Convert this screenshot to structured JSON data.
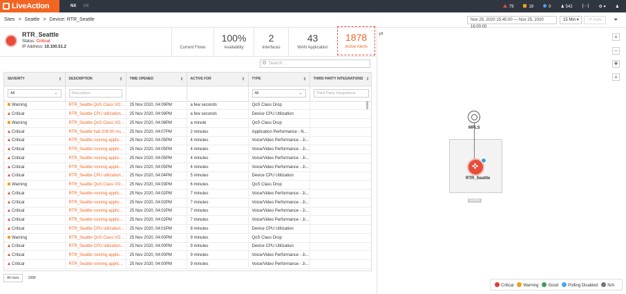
{
  "app": {
    "logo_text": "LiveAction",
    "tabs": [
      "NX",
      "UX"
    ]
  },
  "topbar": {
    "critical_count": "79",
    "warning_count": "19",
    "other_count": "0",
    "users_count": "542",
    "menu_label": "{···}"
  },
  "breadcrumb": [
    "Sites",
    ">",
    "Seattle",
    ">",
    "Device: RTR_Seattle"
  ],
  "timebar": {
    "range": "Nov 25, 2020 15:45:00 — Nov 25, 2020 16:00:00",
    "interval": "15 Min",
    "auto_label": "Auto"
  },
  "device": {
    "name": "RTR_Seattle",
    "status_label": "Status:",
    "status_value": "Critical",
    "ip_label": "IP Address:",
    "ip_value": "10.100.51.2"
  },
  "kpis": [
    {
      "value": "",
      "label": "Current Flows"
    },
    {
      "value": "100%",
      "label": "Availability"
    },
    {
      "value": "2",
      "label": "Interfaces"
    },
    {
      "value": "43",
      "label": "WAN Application"
    },
    {
      "value": "1878",
      "label": "Active Alerts"
    }
  ],
  "search": {
    "placeholder": "Search..."
  },
  "table": {
    "columns": [
      "SEVERITY",
      "DESCRIPTION",
      "TIME OPENED",
      "ACTIVE FOR",
      "TYPE",
      "THIRD PARTY INTEGRATIONS"
    ],
    "filters": {
      "severity": "All",
      "description": "Description",
      "type": "All",
      "integrations": "Third Party Integrations"
    },
    "rows": [
      {
        "sev": "Warning",
        "desc": "RTR_Seattle QoS Class VOIC...",
        "time": "25 Nov 2020, 04:09PM",
        "active": "a few seconds",
        "type": "QoS Class Drop"
      },
      {
        "sev": "Critical",
        "desc": "RTR_Seattle CPU utilization is...",
        "time": "25 Nov 2020, 04:09PM",
        "active": "a few seconds",
        "type": "Device CPU Utilization"
      },
      {
        "sev": "Warning",
        "desc": "RTR_Seattle QoS Class VOIC...",
        "time": "25 Nov 2020, 04:08PM",
        "active": "a minute",
        "type": "QoS Class Drop"
      },
      {
        "sev": "Critical",
        "desc": "RTR_Seattle had 208.00 ms n...",
        "time": "25 Nov 2020, 04:07PM",
        "active": "2 minutes",
        "type": "Application Performance - Ne..."
      },
      {
        "sev": "Critical",
        "desc": "RTR_Seattle running applicati...",
        "time": "25 Nov 2020, 04:05PM",
        "active": "4 minutes",
        "type": "Voice/Video Performance - Ji..."
      },
      {
        "sev": "Critical",
        "desc": "RTR_Seattle running applicati...",
        "time": "25 Nov 2020, 04:05PM",
        "active": "4 minutes",
        "type": "Voice/Video Performance - Ji..."
      },
      {
        "sev": "Critical",
        "desc": "RTR_Seattle running applicati...",
        "time": "25 Nov 2020, 04:05PM",
        "active": "4 minutes",
        "type": "Voice/Video Performance - Ji..."
      },
      {
        "sev": "Critical",
        "desc": "RTR_Seattle running applicati...",
        "time": "25 Nov 2020, 04:05PM",
        "active": "4 minutes",
        "type": "Voice/Video Performance - Ji..."
      },
      {
        "sev": "Critical",
        "desc": "RTR_Seattle CPU utilization is...",
        "time": "25 Nov 2020, 04:04PM",
        "active": "5 minutes",
        "type": "Device CPU Utilization"
      },
      {
        "sev": "Warning",
        "desc": "RTR_Seattle QoS Class VOIC...",
        "time": "25 Nov 2020, 04:03PM",
        "active": "6 minutes",
        "type": "QoS Class Drop"
      },
      {
        "sev": "Critical",
        "desc": "RTR_Seattle running applicati...",
        "time": "25 Nov 2020, 04:02PM",
        "active": "7 minutes",
        "type": "Voice/Video Performance - Ji..."
      },
      {
        "sev": "Critical",
        "desc": "RTR_Seattle running applicati...",
        "time": "25 Nov 2020, 04:02PM",
        "active": "7 minutes",
        "type": "Voice/Video Performance - Ji..."
      },
      {
        "sev": "Critical",
        "desc": "RTR_Seattle running applicati...",
        "time": "25 Nov 2020, 04:02PM",
        "active": "7 minutes",
        "type": "Voice/Video Performance - Ji..."
      },
      {
        "sev": "Critical",
        "desc": "RTR_Seattle running applicati...",
        "time": "25 Nov 2020, 04:02PM",
        "active": "7 minutes",
        "type": "Voice/Video Performance - Ji..."
      },
      {
        "sev": "Critical",
        "desc": "RTR_Seattle CPU utilization is...",
        "time": "25 Nov 2020, 04:01PM",
        "active": "8 minutes",
        "type": "Device CPU Utilization"
      },
      {
        "sev": "Warning",
        "desc": "RTR_Seattle QoS Class VOIC...",
        "time": "25 Nov 2020, 04:00PM",
        "active": "9 minutes",
        "type": "QoS Class Drop"
      },
      {
        "sev": "Critical",
        "desc": "RTR_Seattle CPU utilization is...",
        "time": "25 Nov 2020, 04:00PM",
        "active": "9 minutes",
        "type": "Device CPU Utilization"
      },
      {
        "sev": "Critical",
        "desc": "RTR_Seattle running applicati...",
        "time": "25 Nov 2020, 04:00PM",
        "active": "9 minutes",
        "type": "Voice/Video Performance - Ji..."
      },
      {
        "sev": "Critical",
        "desc": "RTR_Seattle running applicati...",
        "time": "25 Nov 2020, 04:00PM",
        "active": "9 minutes",
        "type": "Voice/Video Performance - Ji..."
      }
    ]
  },
  "footer": {
    "rows_label": "All rows",
    "count": "1888"
  },
  "topology": {
    "mpls_label": "MPLS",
    "router_label": "RTR_Seattle",
    "site_label": "Seattle"
  },
  "legend": [
    {
      "label": "Critical",
      "color": "#e53935"
    },
    {
      "label": "Warning",
      "color": "#f0a020"
    },
    {
      "label": "Good",
      "color": "#43a047"
    },
    {
      "label": "Polling Disabled",
      "color": "#42a5f5"
    },
    {
      "label": "N/A",
      "color": "#757575"
    }
  ]
}
